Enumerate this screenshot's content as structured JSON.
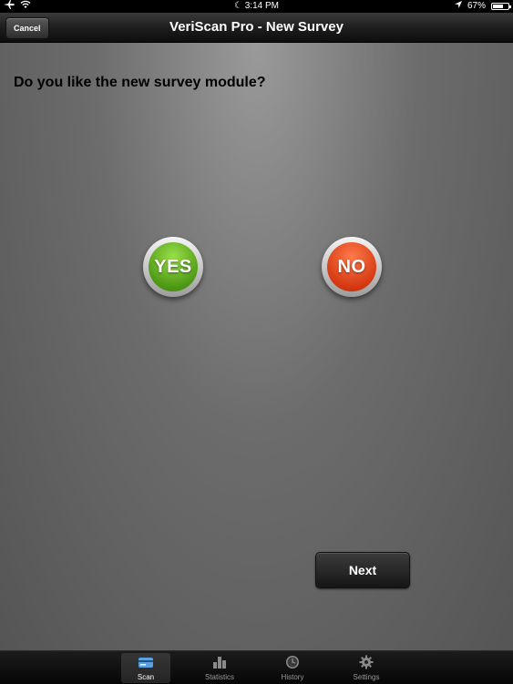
{
  "status_bar": {
    "time": "3:14 PM",
    "battery_text": "67%",
    "battery_level": 0.67
  },
  "nav": {
    "title": "VeriScan Pro - New Survey",
    "cancel_label": "Cancel"
  },
  "survey": {
    "question": "Do you like the new survey module?",
    "yes_label": "YES",
    "no_label": "NO",
    "next_label": "Next"
  },
  "tabs": [
    {
      "label": "Scan",
      "icon": "id-card-icon",
      "active": true
    },
    {
      "label": "Statistics",
      "icon": "bar-chart-icon",
      "active": false
    },
    {
      "label": "History",
      "icon": "clock-icon",
      "active": false
    },
    {
      "label": "Settings",
      "icon": "gear-icon",
      "active": false
    }
  ],
  "colors": {
    "yes": "#5aa81c",
    "no": "#e0461a"
  }
}
